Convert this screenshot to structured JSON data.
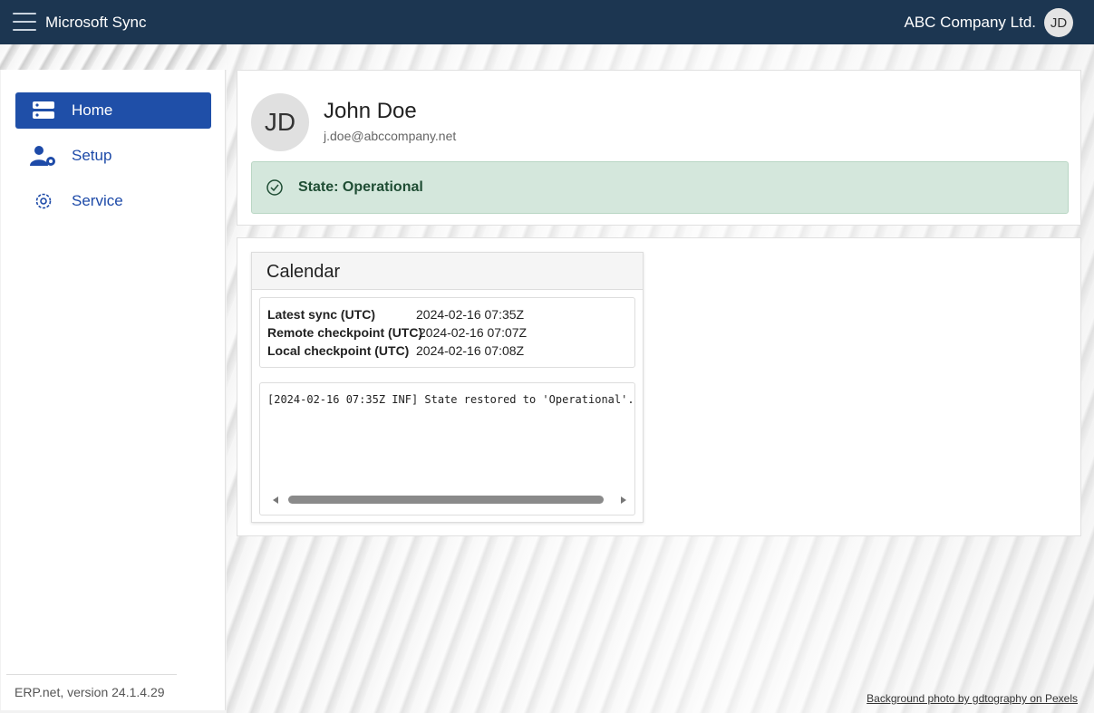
{
  "header": {
    "app_title": "Microsoft Sync",
    "company": "ABC Company Ltd.",
    "avatar_initials": "JD",
    "bg_color": "#1c3651"
  },
  "sidebar": {
    "items": [
      {
        "label": "Home",
        "icon": "server-icon",
        "active": true
      },
      {
        "label": "Setup",
        "icon": "user-gear-icon",
        "active": false
      },
      {
        "label": "Service",
        "icon": "gear-icon",
        "active": false
      }
    ],
    "version": "ERP.net, version 24.1.4.29",
    "active_color": "#1f4fa8"
  },
  "profile": {
    "initials": "JD",
    "name": "John Doe",
    "email": "j.doe@abccompany.net",
    "state_label": "State: Operational",
    "state_color": "#d4e7dc"
  },
  "calendar": {
    "title": "Calendar",
    "rows": [
      {
        "label": "Latest sync (UTC)",
        "value": "2024-02-16 07:35Z"
      },
      {
        "label": "Remote checkpoint (UTC)",
        "value": "2024-02-16 07:07Z"
      },
      {
        "label": "Local checkpoint (UTC)",
        "value": "2024-02-16 07:08Z"
      }
    ],
    "log": "[2024-02-16 07:35Z INF] State restored to 'Operational'."
  },
  "footer": {
    "credit": "Background photo by gdtography on Pexels"
  }
}
